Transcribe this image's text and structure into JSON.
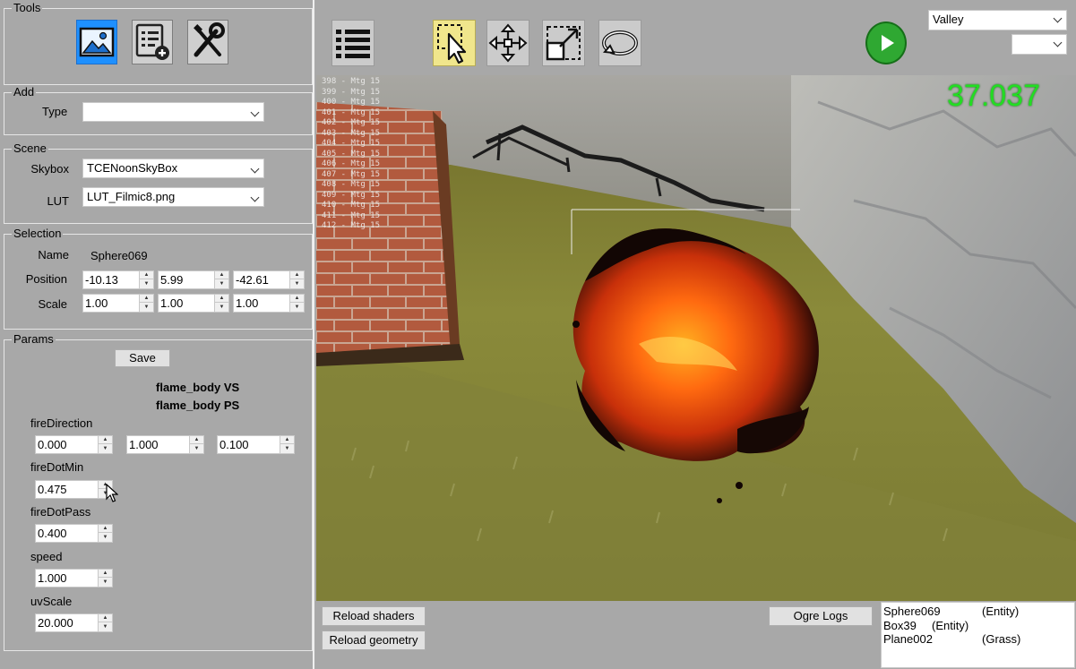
{
  "tools": {
    "title": "Tools",
    "buttons": [
      {
        "icon": "image-icon",
        "active": true
      },
      {
        "icon": "list-add-icon",
        "active": false
      },
      {
        "icon": "wrench-screwdriver-icon",
        "active": false
      }
    ]
  },
  "add": {
    "title": "Add",
    "type_label": "Type",
    "type_value": ""
  },
  "scene": {
    "title": "Scene",
    "skybox_label": "Skybox",
    "skybox_value": "TCENoonSkyBox",
    "lut_label": "LUT",
    "lut_value": "LUT_Filmic8.png"
  },
  "selection": {
    "title": "Selection",
    "name_label": "Name",
    "name_value": "Sphere069",
    "position_label": "Position",
    "position": [
      "-10.13",
      "5.99",
      "-42.61"
    ],
    "scale_label": "Scale",
    "scale": [
      "1.00",
      "1.00",
      "1.00"
    ]
  },
  "params": {
    "title": "Params",
    "save_label": "Save",
    "shader_vs": "flame_body VS",
    "shader_ps": "flame_body PS",
    "fire_direction": {
      "label": "fireDirection",
      "values": [
        "0.000",
        "1.000",
        "0.100"
      ]
    },
    "fire_dot_min": {
      "label": "fireDotMin",
      "value": "0.475"
    },
    "fire_dot_pass": {
      "label": "fireDotPass",
      "value": "0.400"
    },
    "speed": {
      "label": "speed",
      "value": "1.000"
    },
    "uv_scale": {
      "label": "uvScale",
      "value": "20.000"
    }
  },
  "toolbar": {
    "buttons": [
      {
        "icon": "menu-list-icon",
        "active": false
      },
      {
        "icon": "select-cursor-icon",
        "active": true
      },
      {
        "icon": "move-arrows-icon",
        "active": false
      },
      {
        "icon": "scale-icon",
        "active": false
      },
      {
        "icon": "rotate-icon",
        "active": false
      }
    ],
    "play_icon": "play-icon",
    "map_select": "Valley",
    "second_select": ""
  },
  "viewport": {
    "fps": "37.037",
    "overlay_lines": [
      "398 - Mtg 15",
      "399 - Mtg 15",
      "400 - Mtg 15",
      "401 - Mtg 15",
      "402 - Mtg 15",
      "403 - Mtg 15",
      "404 - Mtg 15",
      "405 - Mtg 15",
      "406 - Mtg 15",
      "407 - Mtg 15",
      "408 - Mtg 15",
      "409 - Mtg 15",
      "410 - Mtg 15",
      "411 - Mtg 15",
      "412 - Mtg 15"
    ]
  },
  "bottom": {
    "reload_shaders": "Reload shaders",
    "reload_geometry": "Reload geometry",
    "ogre_logs": "Ogre Logs",
    "entities": [
      {
        "name": "Sphere069",
        "type": "(Entity)"
      },
      {
        "name": "Box39",
        "type": "(Entity)"
      },
      {
        "name": "Plane002",
        "type": "(Grass)"
      }
    ]
  },
  "colors": {
    "panel_bg": "#a8a8a8",
    "active_tool": "#1e90ff",
    "active_toolbar": "#f0e68c",
    "play_green": "#2fa832",
    "fps_green": "#22dd22"
  }
}
